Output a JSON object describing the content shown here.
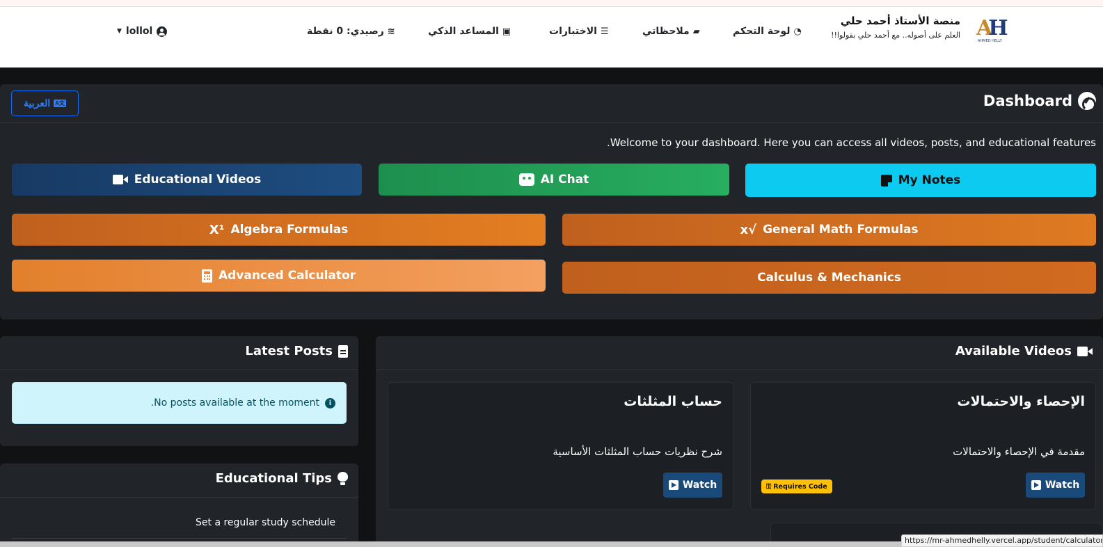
{
  "navbar": {
    "brand_title": "منصة الأستاذ أحمد حلي",
    "brand_subtitle": "العلم على أصوله.. مع أحمد حلي بقولوا!!",
    "logo_text": "AH",
    "logo_caption": "AHMED HELLY",
    "items": [
      {
        "label": "لوحة التحكم",
        "icon": "gauge-icon"
      },
      {
        "label": "ملاحظاتي",
        "icon": "sticky-note-icon"
      },
      {
        "label": "الاختبارات",
        "icon": "list-check-icon"
      },
      {
        "label": "المساعد الذكي",
        "icon": "robot-icon"
      },
      {
        "label": "رصيدي: 0 نقطة",
        "icon": "coins-icon"
      }
    ],
    "user_name": "lollol"
  },
  "dashboard": {
    "title": "Dashboard",
    "lang_button": "العربية",
    "welcome": "Welcome to your dashboard. Here you can access all videos, posts, and educational features.",
    "buttons": {
      "my_notes": "My Notes",
      "ai_chat": "AI Chat",
      "educational_videos": "Educational Videos",
      "general_math": "General Math Formulas",
      "algebra": "Algebra Formulas",
      "calculus": "Calculus & Mechanics",
      "advanced_calc": "Advanced Calculator"
    }
  },
  "latest_posts": {
    "title": "Latest Posts",
    "empty_message": "No posts available at the moment."
  },
  "tips": {
    "title": "Educational Tips",
    "items": [
      "Set a regular study schedule"
    ]
  },
  "videos": {
    "title": "Available Videos",
    "cards": [
      {
        "title": "الإحصاء والاحتمالات",
        "description": "مقدمة في الإحصاء والاحتمالات",
        "watch": "Watch",
        "badge": "Requires Code"
      },
      {
        "title": "حساب المثلثات",
        "description": "شرح نظريات حساب المثلثات الأساسية",
        "watch": "Watch"
      }
    ]
  },
  "status_url": "https://mr-ahmedhelly.vercel.app/student/calculator/a",
  "colors": {
    "background": "#111213",
    "card": "#212428",
    "info": "#0dcaf0",
    "success": "#27ae60",
    "primary_dark": "#1e4d80",
    "orange": "#df7a22",
    "warning": "#ffc107"
  }
}
